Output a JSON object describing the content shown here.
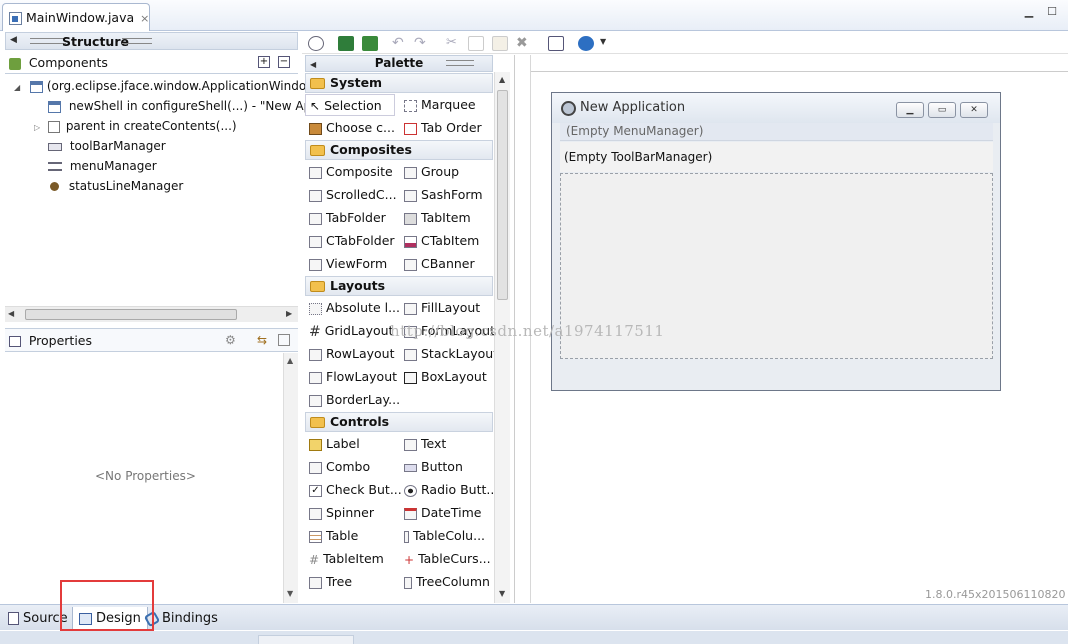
{
  "editor": {
    "tab_label": "MainWindow.java",
    "close_glyph": "×"
  },
  "structure": {
    "title": "Structure"
  },
  "components": {
    "title": "Components",
    "tree": [
      "(org.eclipse.jface.window.ApplicationWindo",
      "newShell in configureShell(...) - \"New Ap",
      "parent in createContents(...)",
      "toolBarManager",
      "menuManager",
      "statusLineManager"
    ]
  },
  "properties": {
    "title": "Properties",
    "empty": "<No Properties>"
  },
  "palette": {
    "title": "Palette",
    "categories": {
      "system": "System",
      "composites": "Composites",
      "layouts": "Layouts",
      "controls": "Controls"
    },
    "system_items": [
      "Selection",
      "Marquee",
      "Choose c...",
      "Tab Order"
    ],
    "composite_items": [
      "Composite",
      "Group",
      "ScrolledC...",
      "SashForm",
      "TabFolder",
      "TabItem",
      "CTabFolder",
      "CTabItem",
      "ViewForm",
      "CBanner"
    ],
    "layout_items": [
      "Absolute l...",
      "FillLayout",
      "GridLayout",
      "FormLayout",
      "RowLayout",
      "StackLayout",
      "FlowLayout",
      "BoxLayout",
      "BorderLay..."
    ],
    "control_items": [
      "Label",
      "Text",
      "Combo",
      "Button",
      "Check But...",
      "Radio Butt...",
      "Spinner",
      "DateTime",
      "Table",
      "TableColu...",
      "TableItem",
      "TableCurs...",
      "Tree",
      "TreeColumn"
    ]
  },
  "shell": {
    "title": "New Application",
    "menu": "(Empty MenuManager)",
    "toolbar": "(Empty ToolBarManager)"
  },
  "watermark": "http://blog.csdn.net/a1974117511",
  "version": "1.8.0.r45x201506110820",
  "bottom_tabs": [
    "Source",
    "Design",
    "Bindings"
  ],
  "colors": {
    "accent": "#e33b3b",
    "panel": "#dde4ee"
  }
}
